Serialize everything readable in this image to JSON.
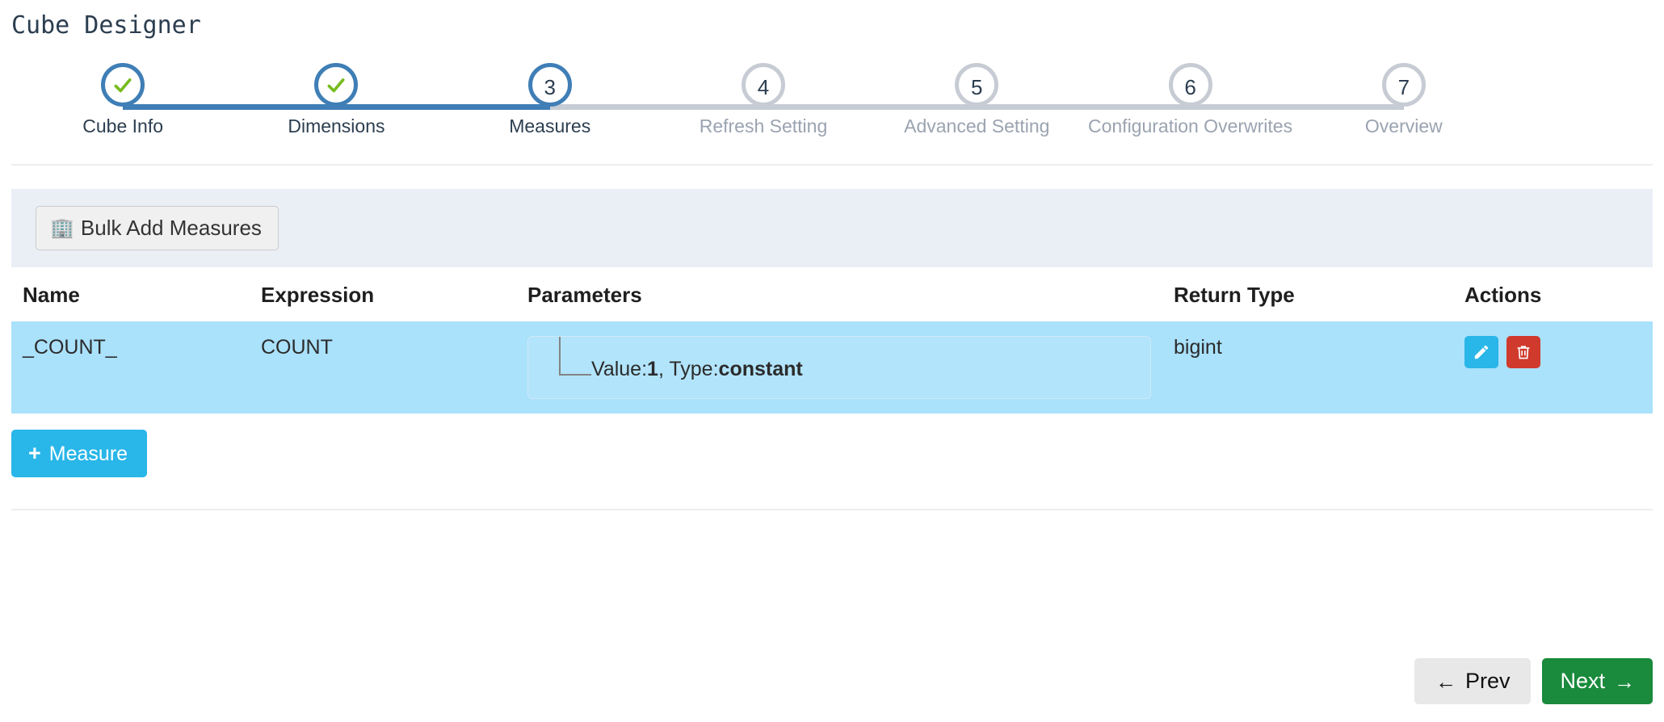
{
  "page": {
    "title": "Cube Designer"
  },
  "stepper": {
    "steps": [
      {
        "number": "1",
        "label": "Cube Info",
        "state": "done"
      },
      {
        "number": "2",
        "label": "Dimensions",
        "state": "done"
      },
      {
        "number": "3",
        "label": "Measures",
        "state": "active"
      },
      {
        "number": "4",
        "label": "Refresh Setting",
        "state": "pending"
      },
      {
        "number": "5",
        "label": "Advanced Setting",
        "state": "pending"
      },
      {
        "number": "6",
        "label": "Configuration Overwrites",
        "state": "pending"
      },
      {
        "number": "7",
        "label": "Overview",
        "state": "pending"
      }
    ],
    "colors": {
      "active": "#3f7eb6",
      "pending": "#c7ccd4",
      "check": "#77bc1f",
      "label_active": "#2c3e50",
      "label_pending": "#9aa3b0"
    }
  },
  "toolbar": {
    "bulk_add_label": "Bulk Add Measures",
    "bulk_add_icon": "building-icon",
    "background": "#eaeef5"
  },
  "table": {
    "headers": {
      "name": "Name",
      "expression": "Expression",
      "parameters": "Parameters",
      "return_type": "Return Type",
      "actions": "Actions"
    },
    "rows": [
      {
        "name": "_COUNT_",
        "expression": "COUNT",
        "parameters": [
          {
            "value_label": "Value:",
            "value": "1",
            "separator": ", ",
            "type_label": "Type:",
            "type": "constant"
          }
        ],
        "return_type": "bigint",
        "selected": true,
        "actions": {
          "edit_icon": "pencil-icon",
          "edit_color": "#29b6e8",
          "delete_icon": "trash-icon",
          "delete_color": "#cf3a2d"
        }
      }
    ],
    "selected_row_color": "#aae1fb"
  },
  "add_measure": {
    "label": "Measure",
    "plus": "+",
    "color": "#29b6e8"
  },
  "footer": {
    "prev_label": "Prev",
    "prev_arrow": "←",
    "next_label": "Next",
    "next_arrow": "→",
    "next_color": "#1a8a3c",
    "prev_color": "#e8e8e8"
  }
}
